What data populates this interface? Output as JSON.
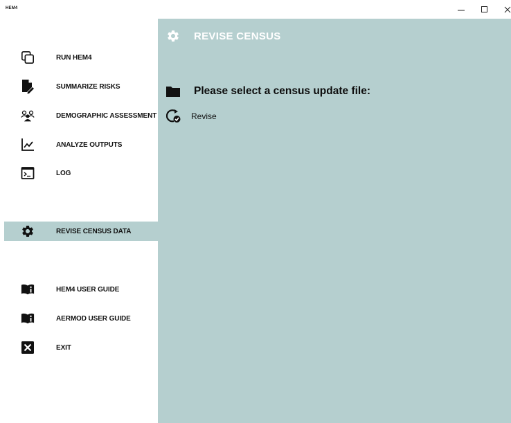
{
  "window": {
    "title": "HEM4",
    "controls": [
      "minimize",
      "maximize",
      "close"
    ]
  },
  "sidebar": {
    "items": [
      {
        "label": "RUN HEM4",
        "icon": "copy-windows-icon"
      },
      {
        "label": "SUMMARIZE RISKS",
        "icon": "document-edit-icon"
      },
      {
        "label": "DEMOGRAPHIC ASSESSMENT",
        "icon": "people-group-icon"
      },
      {
        "label": "ANALYZE OUTPUTS",
        "icon": "line-chart-icon"
      },
      {
        "label": "LOG",
        "icon": "terminal-icon"
      },
      {
        "label": "REVISE CENSUS DATA",
        "icon": "gear-icon",
        "active": true
      },
      {
        "label": "HEM4 USER GUIDE",
        "icon": "book-info-icon"
      },
      {
        "label": "AERMOD USER GUIDE",
        "icon": "book-info-icon"
      },
      {
        "label": "EXIT",
        "icon": "close-box-icon"
      }
    ]
  },
  "main": {
    "header_title": "REVISE CENSUS",
    "header_icon": "gear-icon",
    "prompt": "Please select a census update file:",
    "prompt_icon": "folder-icon",
    "revise_label": "Revise",
    "revise_icon": "refresh-check-icon"
  },
  "colors": {
    "accent_panel": "#b5cfcf",
    "header_text": "#ffffff",
    "sidebar_bg": "#ffffff"
  }
}
